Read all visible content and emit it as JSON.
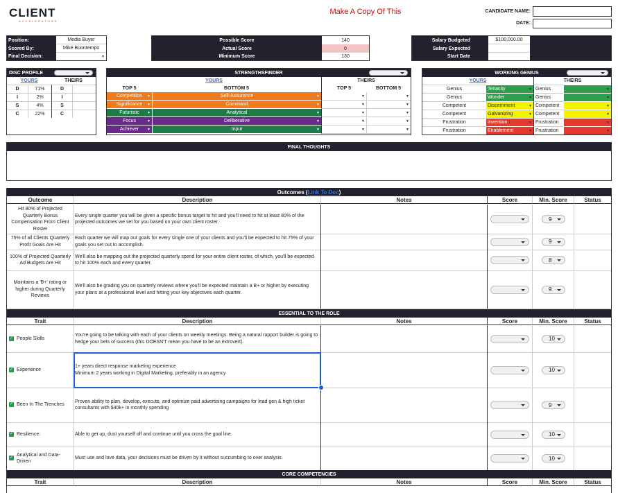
{
  "logo": {
    "text_main": "CLIENT",
    "text_sub": "ACCELERATORS"
  },
  "banner": "Make A Copy Of This",
  "candidate": {
    "name_label": "CANDIDATE NAME:",
    "date_label": "DATE:"
  },
  "info": {
    "position_label": "Position:",
    "position_value": "Media Buyer",
    "scored_label": "Scored By:",
    "scored_value": "Mike Buontempo",
    "decision_label": "Final Decision:"
  },
  "scores": {
    "possible_label": "Possible Score",
    "possible_value": "140",
    "actual_label": "Actual Score",
    "actual_value": "0",
    "minimum_label": "Minimum Score",
    "minimum_value": "130"
  },
  "salary": {
    "budgeted_label": "Salary Budgeted",
    "budgeted_value": "$100,000.00",
    "expected_label": "Salary Expected",
    "start_label": "Start Date"
  },
  "disc": {
    "title": "DISC PROFILE",
    "yours": "YOURS",
    "theirs": "THEIRS",
    "rows": [
      {
        "letter": "D",
        "pct": "71%",
        "their": "D"
      },
      {
        "letter": "I",
        "pct": "2%",
        "their": "I"
      },
      {
        "letter": "S",
        "pct": "4%",
        "their": "S"
      },
      {
        "letter": "C",
        "pct": "22%",
        "their": "C"
      }
    ]
  },
  "strengths": {
    "title": "STRENGTHSFINDER",
    "yours": "YOURS",
    "theirs": "THEIRS",
    "top5": "TOP 5",
    "bottom5": "BOTTOM 5",
    "rows": [
      {
        "top": "Competition",
        "bottom": "Self-Assurance",
        "top_color": "#f07a1c",
        "bottom_color": "#f07a1c"
      },
      {
        "top": "Significance",
        "bottom": "Command",
        "top_color": "#f07a1c",
        "bottom_color": "#f07a1c"
      },
      {
        "top": "Futuristic",
        "bottom": "Analytical",
        "top_color": "#1f7a4a",
        "bottom_color": "#1f7a4a"
      },
      {
        "top": "Focus",
        "bottom": "Deliberative",
        "top_color": "#6a2a8a",
        "bottom_color": "#6a2a8a"
      },
      {
        "top": "Achiever",
        "bottom": "Input",
        "top_color": "#6a2a8a",
        "bottom_color": "#1f7a4a"
      }
    ]
  },
  "genius": {
    "title": "WORKING GENIUS",
    "yours": "YOURS",
    "theirs": "THEIRS",
    "rows": [
      {
        "level": "Genius",
        "value": "Tenacity",
        "color": "#2e9e4a",
        "their": "Genius",
        "their_color": "#2e9e4a"
      },
      {
        "level": "Genius",
        "value": "Wonder",
        "color": "#2e9e4a",
        "their": "Genius",
        "their_color": "#2e9e4a"
      },
      {
        "level": "Competent",
        "value": "Discernment",
        "color": "#f5f200",
        "their": "Competent",
        "their_color": "#f5f200"
      },
      {
        "level": "Competent",
        "value": "Galvanizing",
        "color": "#f5f200",
        "their": "Competent",
        "their_color": "#f5f200"
      },
      {
        "level": "Frustration",
        "value": "Invention",
        "color": "#e23b2e",
        "their": "Frustration",
        "their_color": "#e23b2e"
      },
      {
        "level": "Frustration",
        "value": "Enablement",
        "color": "#e23b2e",
        "their": "Frustration",
        "their_color": "#e23b2e"
      }
    ]
  },
  "final_thoughts": "FINAL THOUGHTS",
  "outcomes": {
    "title": "Outcomes (",
    "link": "Link To Doc",
    "title_end": ")",
    "headers": {
      "outcome": "Outcome",
      "description": "Description",
      "notes": "Notes",
      "score": "Score",
      "min": "Min. Score",
      "status": "Status"
    },
    "rows": [
      {
        "outcome": "Hit 80% of Projected Quarterly Bonus Compensation From Client Roster",
        "description": "Every single quarter you will be given a specific bonus target to hit and you'll need to hit at least 80% of the projected outcomes we set for you based on your own client roster.",
        "min": "9"
      },
      {
        "outcome": "75% of all Clients Quarterly Profit Goals Are Hit",
        "description": "Each quarter we will map out goals for every single one of your clients and you'll be expected to hit 75% of your goals you set out to accomplish.",
        "min": "9"
      },
      {
        "outcome": "100% of Projected Quarterly Ad Budgets Are Hit",
        "description": "We'll also be mapping out the projected quarterly spend for your entire client roster, of which, you'll be expected to hit 100% each and every quarter.",
        "min": "8"
      },
      {
        "outcome": "Maintains a 'B+' rating or higher during Quarterly Reviews",
        "description": "We'll also be grading you on quarterly reviews where you'll be expected maintain a B+ or higher by executing your plans at a professional level and hitting your key objectives each quarter.",
        "min": "9"
      }
    ]
  },
  "essential": {
    "title": "ESSENTIAL TO THE ROLE",
    "headers": {
      "trait": "Trait",
      "description": "Description",
      "notes": "Notes",
      "score": "Score",
      "min": "Min. Score",
      "status": "Status"
    },
    "rows": [
      {
        "trait": "People Skills",
        "description": "You're going to be talking with each of your clients on weekly meetings. Being a natural rapport builder is going to hedge your bets of success (this DOESN'T mean you have to be an extrovert).",
        "min": "10"
      },
      {
        "trait": "Experience",
        "description": "1+ years direct response marketing experience\nMinimum 2 years working in Digital Marketing, preferably in an agency",
        "min": "10"
      },
      {
        "trait": "Been In The Trenches",
        "description": "Proven ability to plan, develop, execute, and optimize paid advertising campaigns for lead gen & high ticket consultants with $40k+ in monthly spending",
        "min": "9"
      },
      {
        "trait": "Resilience:",
        "description": "Able to get up, dust yourself off and continue until you cross the goal line.",
        "min": "10"
      },
      {
        "trait": "Analytical and Data-Driven",
        "description": "Must use and love data, your decisions must be driven by it without succumbing to over analysis.",
        "min": "10"
      }
    ]
  },
  "core": {
    "title": "CORE COMPETENCIES",
    "headers": {
      "trait": "Trait",
      "description": "Description",
      "notes": "Notes",
      "score": "Score",
      "min": "Min. Score",
      "status": "Status"
    }
  },
  "colors": {
    "dark": "#22222e",
    "link": "#3b6fd6",
    "banner": "#e00000",
    "actual_bg": "#f2c4c4",
    "selection": "#1a5fd0"
  }
}
